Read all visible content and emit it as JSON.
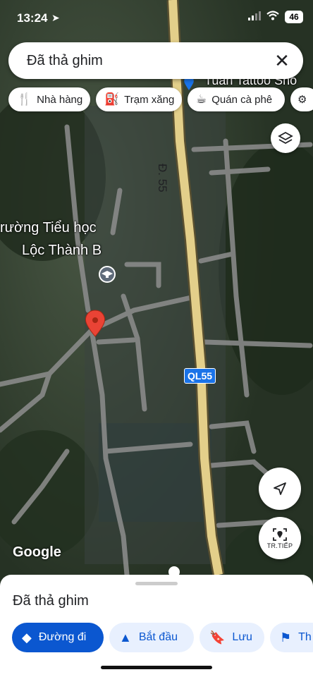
{
  "status_bar": {
    "time": "13:24",
    "battery": "46"
  },
  "search": {
    "query": "Đã thả ghim"
  },
  "chips": [
    {
      "label": "Nhà hàng",
      "icon": "fork-knife-icon"
    },
    {
      "label": "Trạm xăng",
      "icon": "gas-station-icon"
    },
    {
      "label": "Quán cà phê",
      "icon": "coffee-cup-icon"
    }
  ],
  "map_labels": {
    "school_line1": "rường Tiểu học",
    "school_line2": "Lộc Thành B",
    "poi_top": "Tuấn Tattoo Sho",
    "road_vertical": "Đ. 55",
    "road_shield": "QL55",
    "attribution": "Google"
  },
  "controls": {
    "next_label": "TR.TIẾP"
  },
  "sheet": {
    "title": "Đã thả ghim",
    "actions": [
      {
        "label": "Đường đi",
        "icon": "directions-icon"
      },
      {
        "label": "Bắt đầu",
        "icon": "navigation-arrow-icon"
      },
      {
        "label": "Lưu",
        "icon": "bookmark-icon"
      },
      {
        "label": "Th",
        "icon": "flag-icon"
      }
    ]
  },
  "colors": {
    "accent": "#0b57d0",
    "pin": "#ea4335",
    "highway": "#e3cf8a",
    "road": "#8e8e8e"
  }
}
